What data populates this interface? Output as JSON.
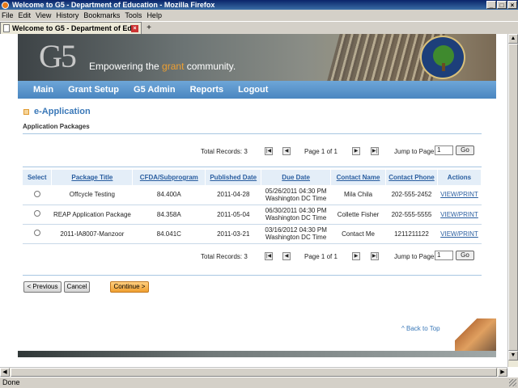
{
  "window": {
    "title": "Welcome to G5 - Department of Education - Mozilla Firefox"
  },
  "menu": [
    "File",
    "Edit",
    "View",
    "History",
    "Bookmarks",
    "Tools",
    "Help"
  ],
  "tab": {
    "label": "Welcome to G5 - Department of Edu..."
  },
  "banner": {
    "logo": "G5",
    "tagline_pre": "Empowering the ",
    "tagline_hl": "grant",
    "tagline_post": " community."
  },
  "nav": [
    "Main",
    "Grant Setup",
    "G5 Admin",
    "Reports",
    "Logout"
  ],
  "section": {
    "title": "e-Application",
    "subtitle": "Application Packages"
  },
  "pager": {
    "total": "Total Records: 3",
    "page": "Page 1 of 1",
    "jump_label": "Jump to Page",
    "jump_value": "1",
    "go": "Go"
  },
  "table": {
    "headers": [
      "Select",
      "Package Title",
      "CFDA/Subprogram",
      "Published Date",
      "Due Date",
      "Contact Name",
      "Contact Phone",
      "Actions"
    ],
    "rows": [
      {
        "title": "Offcycle Testing",
        "cfda": "84.400A",
        "published": "2011-04-28",
        "due1": "05/26/2011 04:30 PM",
        "due2": "Washington DC Time",
        "contact": "Mila Chila",
        "phone": "202-555-2452",
        "action": "VIEW/PRINT"
      },
      {
        "title": "REAP Application Package",
        "cfda": "84.358A",
        "published": "2011-05-04",
        "due1": "06/30/2011 04:30 PM",
        "due2": "Washington DC Time",
        "contact": "Collette Fisher",
        "phone": "202-555-5555",
        "action": "VIEW/PRINT"
      },
      {
        "title": "2011-IA8007-Manzoor",
        "cfda": "84.041C",
        "published": "2011-03-21",
        "due1": "03/16/2012 04:30 PM",
        "due2": "Washington DC Time",
        "contact": "Contact Me",
        "phone": "1211211122",
        "action": "VIEW/PRINT"
      }
    ]
  },
  "buttons": {
    "previous": "< Previous",
    "cancel": "Cancel",
    "continue": "Continue >"
  },
  "back_to_top": "^ Back to Top",
  "status": "Done"
}
